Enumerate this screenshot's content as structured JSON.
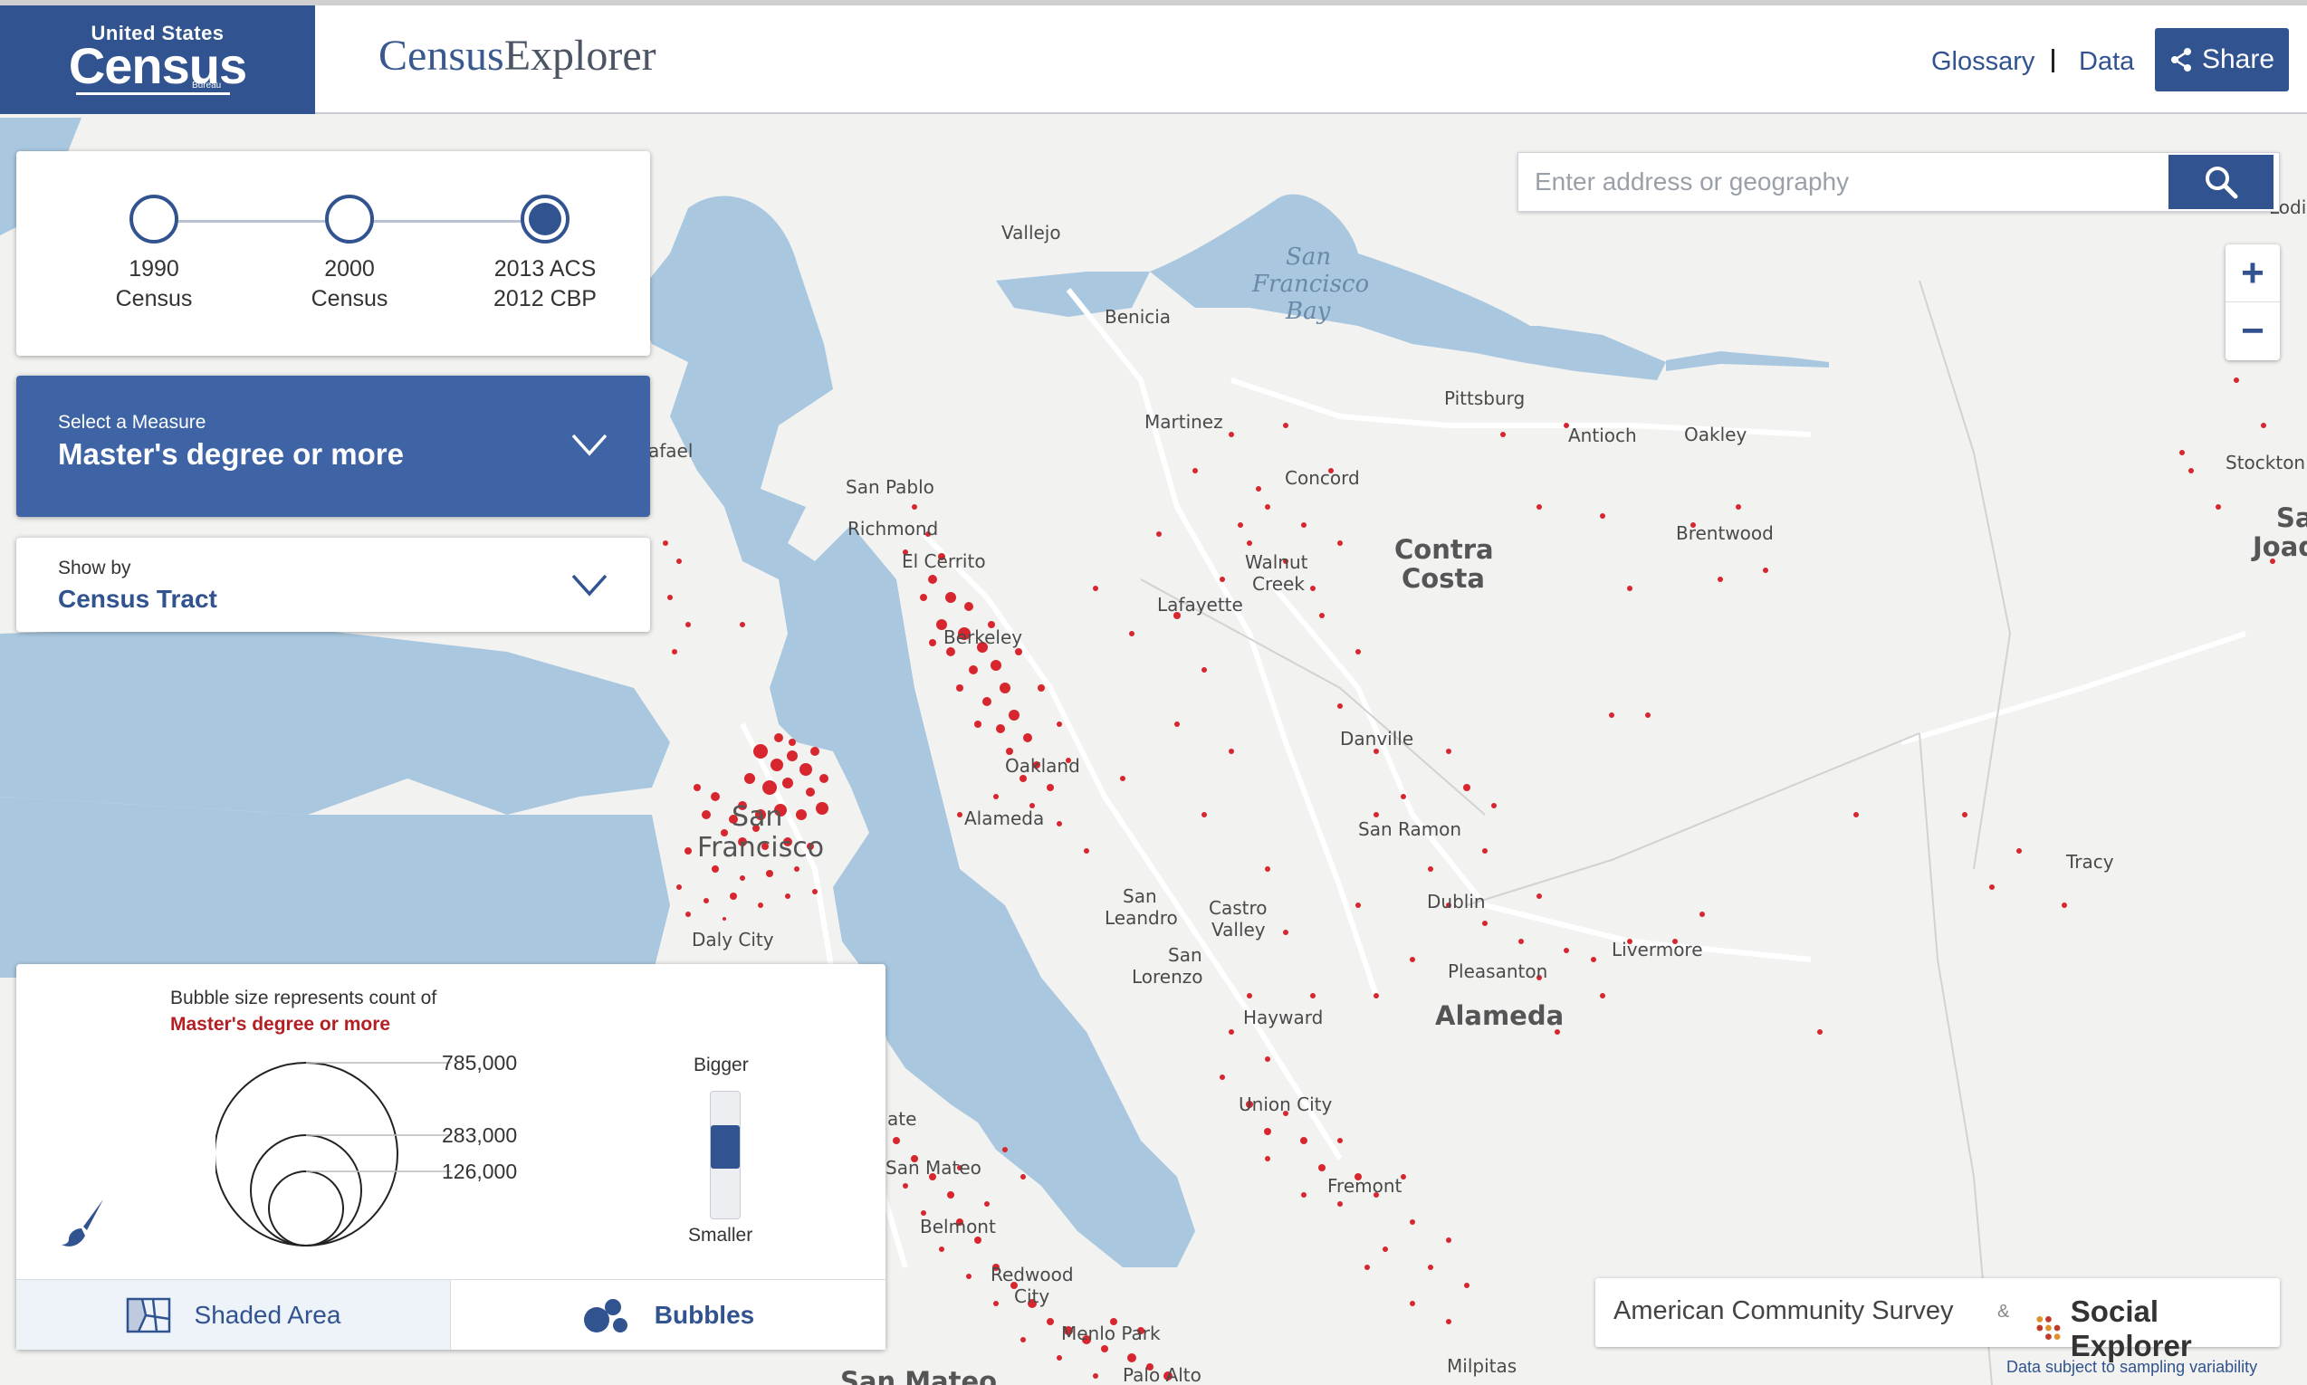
{
  "header": {
    "logo_top": "United States",
    "logo_main": "Census",
    "logo_sub": "Bureau",
    "app_title_1": "Census",
    "app_title_2": "Explorer",
    "nav": {
      "glossary": "Glossary",
      "separator": "I",
      "data": "Data"
    },
    "share_label": "Share"
  },
  "timeline": [
    {
      "line1": "1990",
      "line2": "Census",
      "selected": false
    },
    {
      "line1": "2000",
      "line2": "Census",
      "selected": false
    },
    {
      "line1": "2013 ACS",
      "line2": "2012 CBP",
      "selected": true
    }
  ],
  "measure": {
    "caption": "Select a Measure",
    "value": "Master's degree or more"
  },
  "show_by": {
    "caption": "Show by",
    "value": "Census Tract"
  },
  "search": {
    "placeholder": "Enter address or geography"
  },
  "zoom": {
    "in": "+",
    "out": "−"
  },
  "map_labels": {
    "vallejo": "Vallejo",
    "benicia": "Benicia",
    "bay_1": "San",
    "bay_2": "Francisco",
    "bay_3": "Bay",
    "martinez": "Martinez",
    "pittsburg": "Pittsburg",
    "antioch": "Antioch",
    "oakley": "Oakley",
    "brentwood": "Brentwood",
    "concord": "Concord",
    "walnut_1": "Walnut",
    "walnut_2": "Creek",
    "contra_1": "Contra",
    "contra_2": "Costa",
    "lafayette": "Lafayette",
    "san_pablo": "San Pablo",
    "richmond": "Richmond",
    "el_cerrito": "El Cerrito",
    "berkeley": "Berkeley",
    "oakland": "Oakland",
    "alameda_city": "Alameda",
    "danville": "Danville",
    "san_ramon": "San Ramon",
    "dublin": "Dublin",
    "pleasanton": "Pleasanton",
    "livermore": "Livermore",
    "alameda_county": "Alameda",
    "san_leandro_1": "San",
    "san_leandro_2": "Leandro",
    "castro_1": "Castro",
    "castro_2": "Valley",
    "san_lorenzo_1": "San",
    "san_lorenzo_2": "Lorenzo",
    "hayward": "Hayward",
    "union_city": "Union City",
    "fremont": "Fremont",
    "sf_1": "San",
    "sf_2": "Francisco",
    "daly_city": "Daly City",
    "san_mateo": "San Mateo",
    "belmont": "Belmont",
    "redwood_1": "Redwood",
    "redwood_2": "City",
    "menlo_park": "Menlo Park",
    "palo_alto": "Palo Alto",
    "milpitas": "Milpitas",
    "tracy": "Tracy",
    "stockton": "Stockton",
    "lodi": "Lodi",
    "san_joaq_1": "Sa",
    "san_joaq_2": "Joaq",
    "rafael": "afael",
    "ate": "ate",
    "san_mateo_county": "San Mateo"
  },
  "legend": {
    "title": "Bubble size represents count of",
    "measure": "Master's degree or more",
    "values": [
      "785,000",
      "283,000",
      "126,000"
    ],
    "bigger": "Bigger",
    "smaller": "Smaller",
    "size_level": 0.6,
    "tab_shaded": "Shaded Area",
    "tab_bubbles": "Bubbles",
    "active_tab": "Bubbles"
  },
  "attribution": {
    "acs": "American Community Survey",
    "amp": "&",
    "social_explorer": "Social Explorer",
    "note": "Data subject to sampling variability"
  },
  "colors": {
    "brand_blue": "#31538f",
    "measure_blue": "#3e64a6",
    "bubble_red": "#d7262e",
    "water": "#a9c8e0",
    "land": "#f2f2f0"
  }
}
